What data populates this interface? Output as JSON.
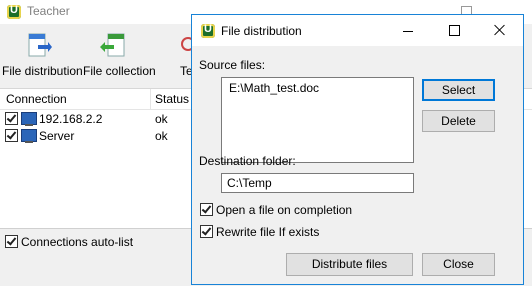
{
  "main_window": {
    "title": "Teacher",
    "toolbar": [
      {
        "label": "File distribution",
        "icon": "file-distribution-icon"
      },
      {
        "label": "File collection",
        "icon": "file-collection-icon"
      },
      {
        "label": "Te",
        "icon": "partial-tool-icon"
      }
    ],
    "list": {
      "columns": [
        "Connection",
        "Status"
      ],
      "rows": [
        {
          "connection": "192.168.2.2",
          "status": "ok",
          "checked": true
        },
        {
          "connection": "Server",
          "status": "ok",
          "checked": true
        }
      ]
    },
    "auto_list": {
      "label": "Connections auto-list",
      "checked": true
    }
  },
  "dialog": {
    "title": "File distribution",
    "source_label": "Source files:",
    "source_files": [
      "E:\\Math_test.doc"
    ],
    "select_button": "Select",
    "delete_button": "Delete",
    "dest_label": "Destination folder:",
    "dest_value": "C:\\Temp",
    "open_on_completion": {
      "label": "Open a file on completion",
      "checked": true
    },
    "rewrite_if_exists": {
      "label": "Rewrite file If exists",
      "checked": true
    },
    "distribute_button": "Distribute files",
    "close_button": "Close"
  },
  "colors": {
    "dialog_border": "#1883d7",
    "default_button_border": "#0078d7",
    "app_icon_green": "#1c6e2a"
  }
}
